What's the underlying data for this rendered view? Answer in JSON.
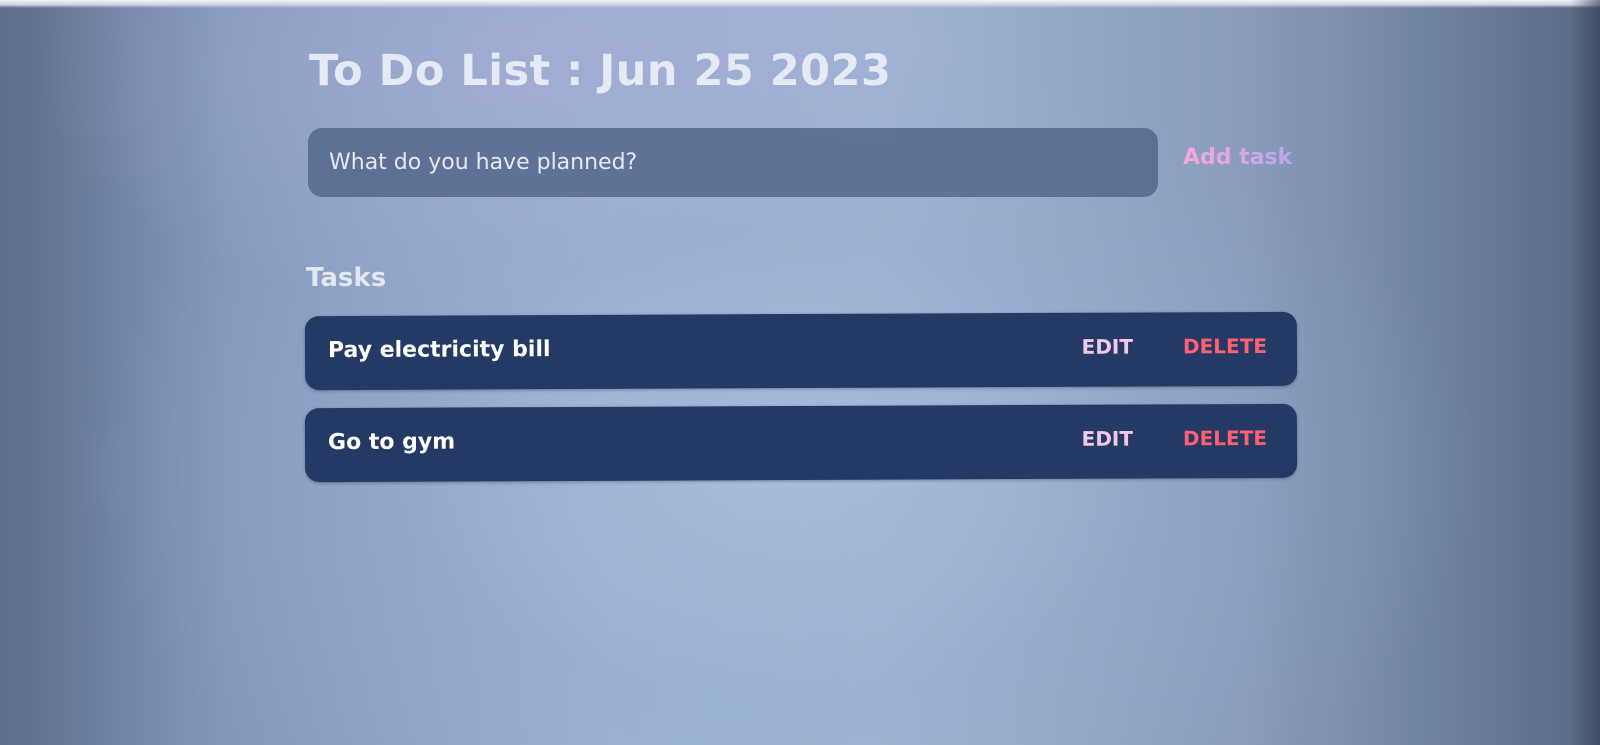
{
  "header": {
    "title": "To Do List :  Jun 25 2023"
  },
  "new_task": {
    "placeholder": "What do you have planned?",
    "value": "",
    "add_label": "Add task"
  },
  "tasks": {
    "heading": "Tasks",
    "items": [
      {
        "label": "Pay electricity bill",
        "edit_label": "EDIT",
        "delete_label": "DELETE"
      },
      {
        "label": "Go to gym",
        "edit_label": "EDIT",
        "delete_label": "DELETE"
      }
    ]
  },
  "colors": {
    "task_background": "#243a65",
    "edit": "#f0c8ea",
    "delete": "#ff5f70",
    "add_task_gradient_start": "#f8a8d8",
    "add_task_gradient_end": "#b9a7ef"
  }
}
